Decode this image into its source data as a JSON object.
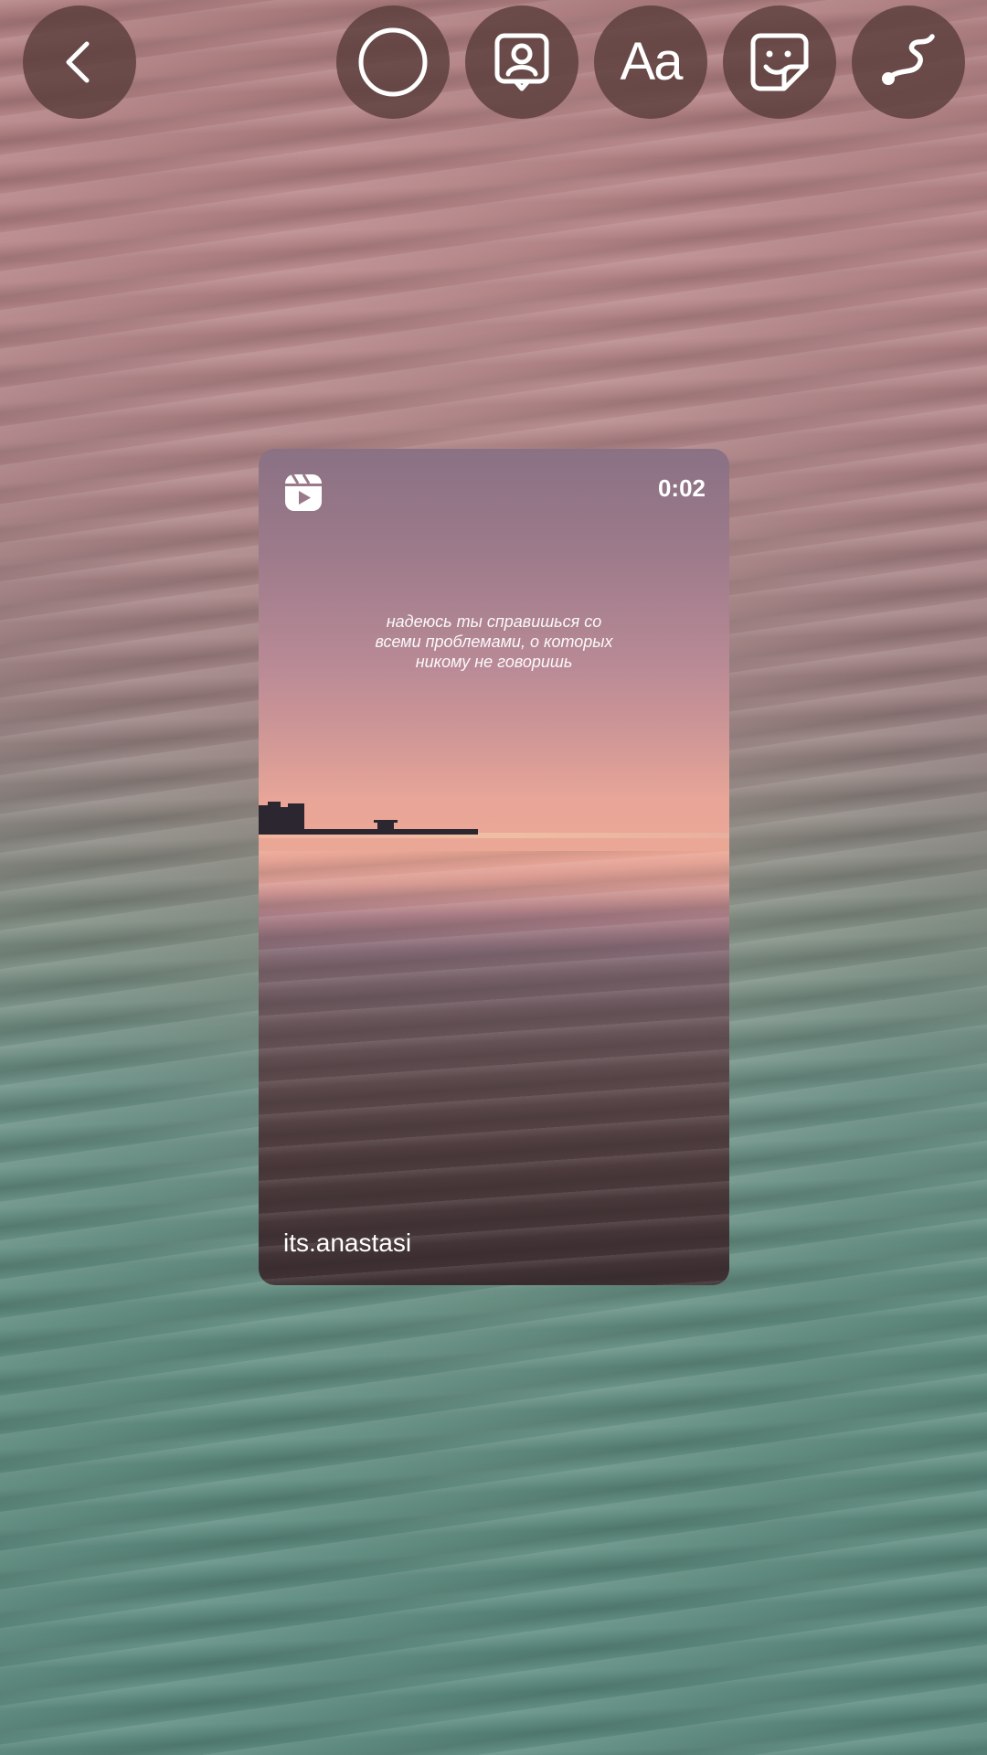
{
  "toolbar": {
    "back_icon": "chevron-left-icon",
    "tools": [
      {
        "name": "capture",
        "icon": "circle-outline-icon"
      },
      {
        "name": "mention",
        "icon": "portrait-icon"
      },
      {
        "name": "text",
        "icon": "text-aa-icon",
        "label": "Aa"
      },
      {
        "name": "sticker",
        "icon": "sticker-face-icon"
      },
      {
        "name": "draw",
        "icon": "squiggle-draw-icon"
      }
    ]
  },
  "reel": {
    "icon": "reels-play-icon",
    "duration": "0:02",
    "caption_lines": [
      "надеюсь ты справишься со",
      "всеми проблемами, о которых",
      "никому не говоришь"
    ],
    "author": "its.anastasi"
  },
  "colors": {
    "button_bg": "#5a3e3c",
    "icon": "#ffffff"
  }
}
